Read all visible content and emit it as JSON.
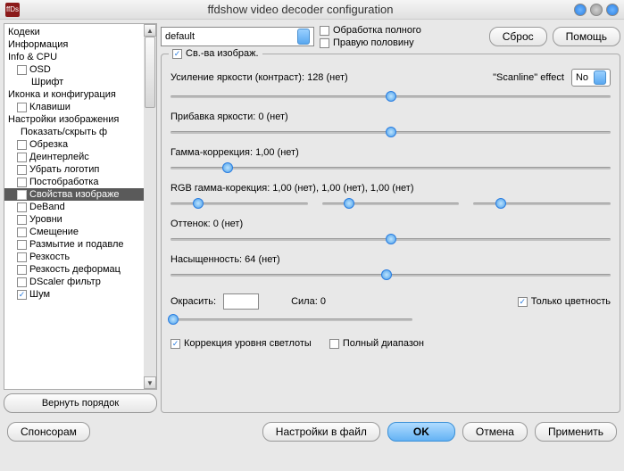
{
  "title": "ffdshow video decoder configuration",
  "logo": "ffDs",
  "sidebar": {
    "items": [
      {
        "label": "Кодеки",
        "pad": 4,
        "cb": null
      },
      {
        "label": "Информация",
        "pad": 4,
        "cb": null
      },
      {
        "label": "Info & CPU",
        "pad": 4,
        "cb": null
      },
      {
        "label": "OSD",
        "pad": 14,
        "cb": false
      },
      {
        "label": "Шрифт",
        "pad": 30,
        "cb": null
      },
      {
        "label": "Иконка и конфигурация",
        "pad": 4,
        "cb": null
      },
      {
        "label": "Клавиши",
        "pad": 14,
        "cb": false
      },
      {
        "label": "Настройки изображения",
        "pad": 4,
        "cb": null
      },
      {
        "label": "Показать/скрыть ф",
        "pad": 18,
        "cb": null
      },
      {
        "label": "Обрезка",
        "pad": 14,
        "cb": false
      },
      {
        "label": "Деинтерлейс",
        "pad": 14,
        "cb": false
      },
      {
        "label": "Убрать логотип",
        "pad": 14,
        "cb": false
      },
      {
        "label": "Постобработка",
        "pad": 14,
        "cb": false
      },
      {
        "label": "Свойства изображе",
        "pad": 14,
        "cb": true,
        "sel": true
      },
      {
        "label": "DeBand",
        "pad": 14,
        "cb": false
      },
      {
        "label": "Уровни",
        "pad": 14,
        "cb": false
      },
      {
        "label": "Смещение",
        "pad": 14,
        "cb": false
      },
      {
        "label": "Размытие и подавле",
        "pad": 14,
        "cb": false
      },
      {
        "label": "Резкость",
        "pad": 14,
        "cb": false
      },
      {
        "label": "Резкость деформац",
        "pad": 14,
        "cb": false
      },
      {
        "label": "DScaler фильтр",
        "pad": 14,
        "cb": false
      },
      {
        "label": "Шум",
        "pad": 14,
        "cb": true
      }
    ],
    "reset_order": "Вернуть порядок"
  },
  "toprow": {
    "preset": "default",
    "full_proc": "Обработка полного",
    "right_half": "Правую половину",
    "reset": "Сброс",
    "help": "Помощь"
  },
  "panel": {
    "head": "Св.-ва изображ.",
    "luma_gain": "Усиление яркости (контраст): 128 (нет)",
    "scanline_lbl": "\"Scanline\" effect",
    "scanline_val": "No",
    "luma_offset": "Прибавка яркости: 0 (нет)",
    "gamma": "Гамма-коррекция: 1,00 (нет)",
    "rgb_gamma": "RGB гамма-корекция: 1,00 (нет), 1,00 (нет), 1,00 (нет)",
    "hue": "Оттенок: 0 (нет)",
    "sat": "Насыщенность: 64 (нет)",
    "colorize": "Окрасить:",
    "strength": "Сила: 0",
    "chroma_only": "Только цветность",
    "luma_corr": "Коррекция уровня светлоты",
    "full_range": "Полный диапазон"
  },
  "footer": {
    "donate": "Спонсорам",
    "export": "Настройки в файл",
    "ok": "OK",
    "cancel": "Отмена",
    "apply": "Применить"
  }
}
